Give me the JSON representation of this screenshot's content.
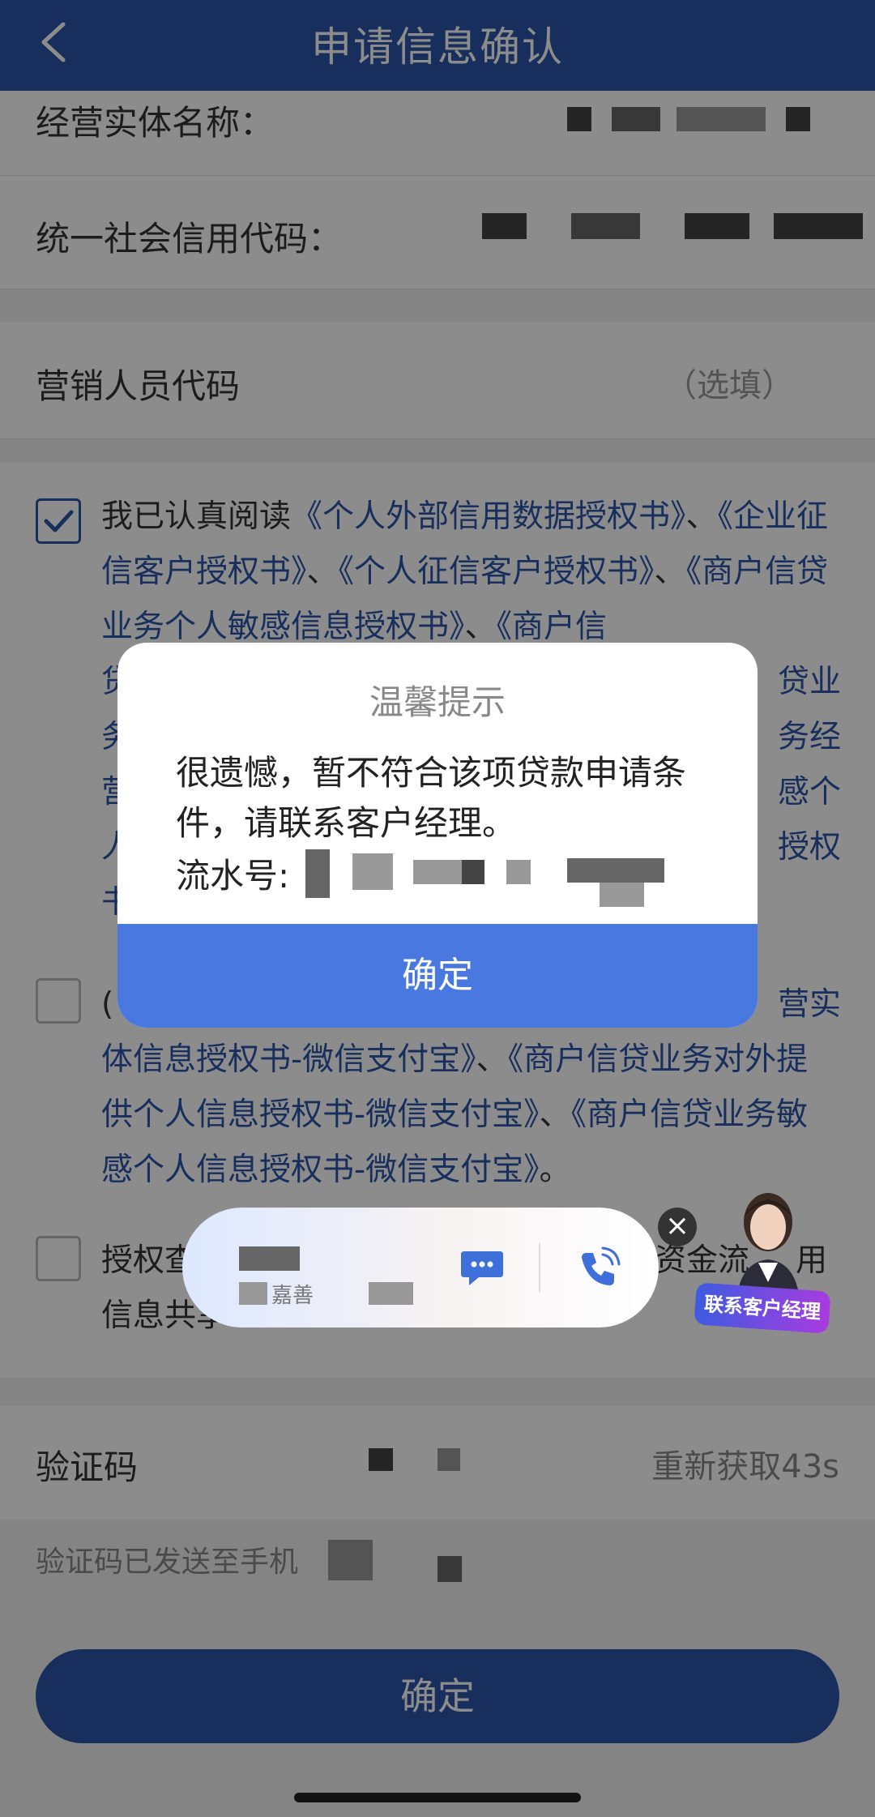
{
  "header": {
    "title": "申请信息确认"
  },
  "form": {
    "entity_name_label": "经营实体名称：",
    "credit_code_label": "统一社会信用代码：",
    "marketer_code_label": "营销人员代码",
    "marketer_code_placeholder": "（选填）"
  },
  "consent": {
    "item1_prefix": "我已认真阅读",
    "item1_links": [
      "《个人外部信用数据授权书》",
      "《企业征信客户授权书》",
      "《个人征信客户授权书》",
      "《商户信贷业务个人敏感信息授权书》",
      "《商户信"
    ],
    "item1_sep": "、",
    "item1_partial_lines": [
      "贷",
      "务",
      "营",
      "人",
      "书"
    ],
    "item1_right_fragments": [
      "贷业",
      "务经",
      "感个",
      "授权"
    ],
    "item2_prefix": "(",
    "item2_fragment": "营实",
    "item2_links": [
      "体信息授权书-微信支付宝》",
      "《商户信贷业务对外",
      "提供个人信息授权书-微信支付宝》",
      "《商户信贷业",
      "务敏感个人信息授权书-微信支付宝》"
    ],
    "item2_end": "。",
    "item3_prefix": "授权查",
    "item3_fragment": "资金流",
    "item3_fragment2": "用",
    "item3_line2": "信息共享"
  },
  "verification": {
    "label": "验证码",
    "resend": "重新获取43s",
    "sent_note": "验证码已发送至手机"
  },
  "bottom_button": {
    "label": "确定"
  },
  "modal": {
    "title": "温馨提示",
    "body": "很遗憾，暂不符合该项贷款申请条件，请联系客户经理。",
    "serial_label": "流水号:",
    "button": "确定"
  },
  "contact_widget": {
    "partial_text": "嘉善",
    "close_symbol": "×",
    "badge": "联系客户经理"
  }
}
